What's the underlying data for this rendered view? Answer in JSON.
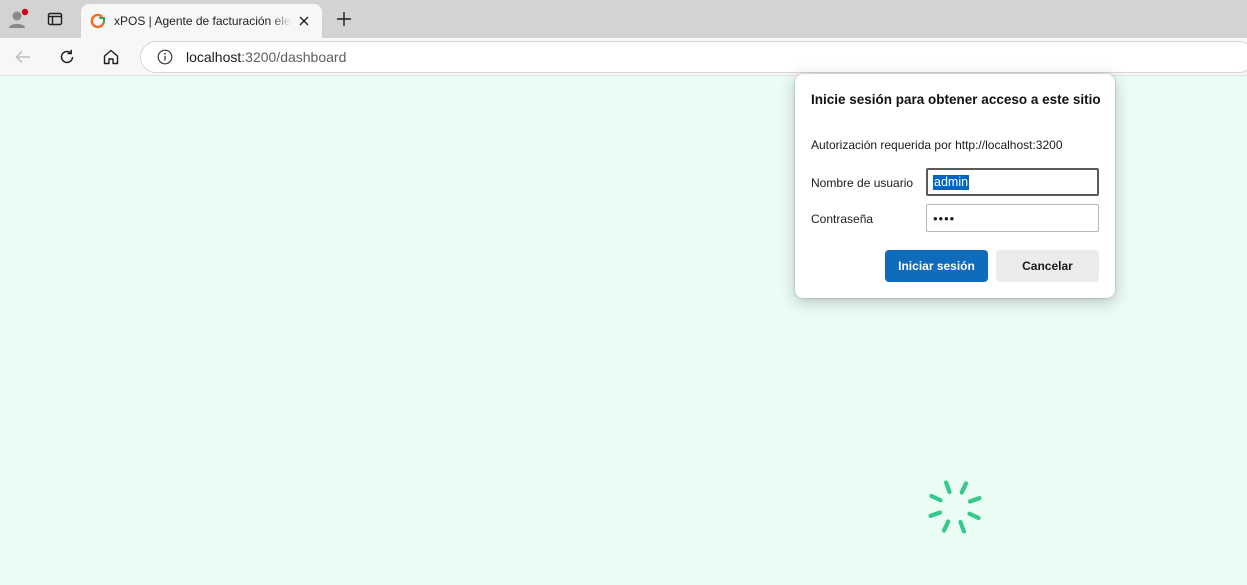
{
  "browser": {
    "tab": {
      "title": "xPOS | Agente de facturación electrónica",
      "favicon": "xpos-favicon"
    },
    "address_bar": {
      "host": "localhost",
      "port_path": ":3200/dashboard"
    },
    "colors": {
      "tabstrip": "#d3d3d3",
      "toolbar": "#f7f7f7",
      "page_background": "#eafcf4"
    }
  },
  "auth_dialog": {
    "title": "Inicie sesión para obtener acceso a este sitio",
    "subtitle": "Autorización requerida por http://localhost:3200",
    "username_label": "Nombre de usuario",
    "username_value": "admin",
    "password_label": "Contraseña",
    "password_masked": "••••",
    "sign_in_label": "Iniciar sesión",
    "cancel_label": "Cancelar",
    "colors": {
      "primary_button": "#0f6cbd",
      "selection": "#0067c0"
    }
  },
  "page": {
    "spinner": "loading-spinner-icon",
    "spinner_color": "#34c98a"
  }
}
